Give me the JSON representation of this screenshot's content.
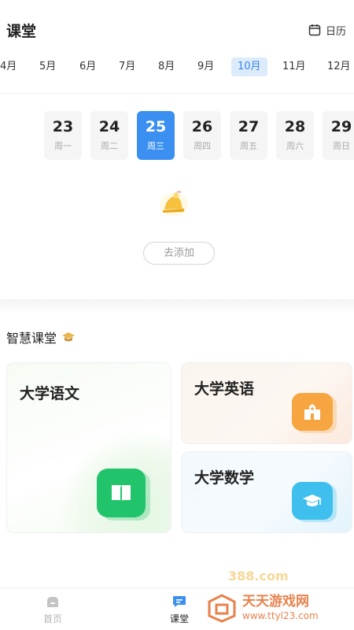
{
  "header": {
    "title": "课堂",
    "calendar_label": "日历"
  },
  "months": [
    "4月",
    "5月",
    "6月",
    "7月",
    "8月",
    "9月",
    "10月",
    "11月",
    "12月"
  ],
  "selected_month": "10月",
  "week": [
    {
      "date": "23",
      "weekday": "周一"
    },
    {
      "date": "24",
      "weekday": "周二"
    },
    {
      "date": "25",
      "weekday": "周三",
      "selected": true
    },
    {
      "date": "26",
      "weekday": "周四"
    },
    {
      "date": "27",
      "weekday": "周五"
    },
    {
      "date": "28",
      "weekday": "周六"
    },
    {
      "date": "29",
      "weekday": "周日"
    }
  ],
  "empty_state": {
    "add_label": "去添加",
    "icon": "bell-icon"
  },
  "smart_class": {
    "title": "智慧课堂",
    "courses": [
      {
        "name": "大学语文",
        "icon": "book-icon",
        "color": "#21c36b"
      },
      {
        "name": "大学英语",
        "icon": "school-icon",
        "color": "#f6a540"
      },
      {
        "name": "大学数学",
        "icon": "graduation-cap-icon",
        "color": "#3fbfee"
      }
    ]
  },
  "tabbar": [
    {
      "label": "首页",
      "icon": "home-icon",
      "active": false
    },
    {
      "label": "课堂",
      "icon": "classroom-icon",
      "active": true
    }
  ],
  "watermark": {
    "text": "天天游戏网",
    "url": "www.ttyl23.com"
  },
  "colors": {
    "accent": "#3a8ff0",
    "month_highlight": "#dcebfb"
  }
}
